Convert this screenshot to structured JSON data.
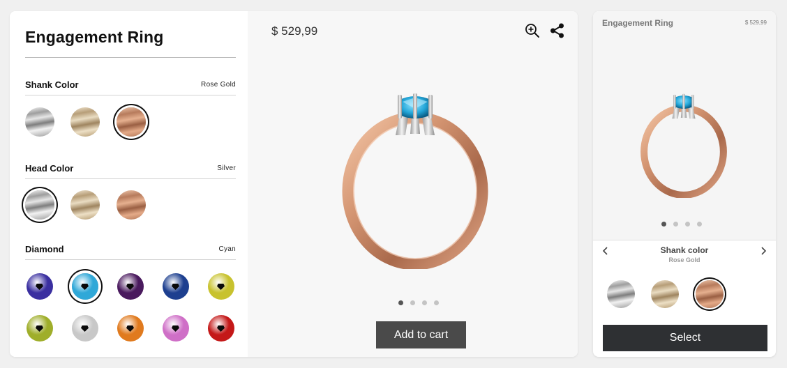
{
  "product": {
    "title": "Engagement Ring",
    "price": "$ 529,99",
    "add_to_cart_label": "Add to cart"
  },
  "sections": {
    "shank": {
      "label": "Shank Color",
      "selected": "Rose Gold",
      "swatches": [
        {
          "name": "silver",
          "selected": false
        },
        {
          "name": "gold",
          "selected": false
        },
        {
          "name": "rose-gold",
          "selected": true
        }
      ]
    },
    "head": {
      "label": "Head Color",
      "selected": "Silver",
      "swatches": [
        {
          "name": "silver",
          "selected": true
        },
        {
          "name": "gold",
          "selected": false
        },
        {
          "name": "rose-gold",
          "selected": false
        }
      ]
    },
    "diamond": {
      "label": "Diamond",
      "selected": "Cyan",
      "gems": [
        {
          "name": "indigo",
          "color": "#3a2fa0",
          "selected": false
        },
        {
          "name": "cyan",
          "color": "#2fa8d8",
          "selected": true
        },
        {
          "name": "purple",
          "color": "#4a1a5e",
          "selected": false
        },
        {
          "name": "blue",
          "color": "#1d3f8f",
          "selected": false
        },
        {
          "name": "yellow",
          "color": "#c8c22e",
          "selected": false
        },
        {
          "name": "lime",
          "color": "#9fae2a",
          "selected": false
        },
        {
          "name": "white",
          "color": "#c8c8c8",
          "selected": false
        },
        {
          "name": "orange",
          "color": "#e07a1e",
          "selected": false
        },
        {
          "name": "pink",
          "color": "#cf6fc7",
          "selected": false
        },
        {
          "name": "red",
          "color": "#c41818",
          "selected": false
        }
      ]
    }
  },
  "carousel": {
    "count": 4,
    "active": 0
  },
  "mobile": {
    "title": "Engagement Ring",
    "price": "$ 529,99",
    "option_label": "Shank color",
    "option_value": "Rose Gold",
    "select_label": "Select",
    "carousel": {
      "count": 4,
      "active": 0
    }
  },
  "icons": [
    "zoom-in-icon",
    "share-icon",
    "chevron-left-icon",
    "chevron-right-icon"
  ],
  "colors": {
    "button_dark": "#4a4a4a",
    "select_button": "#2e3033",
    "rose_gold": "#c98a68"
  }
}
